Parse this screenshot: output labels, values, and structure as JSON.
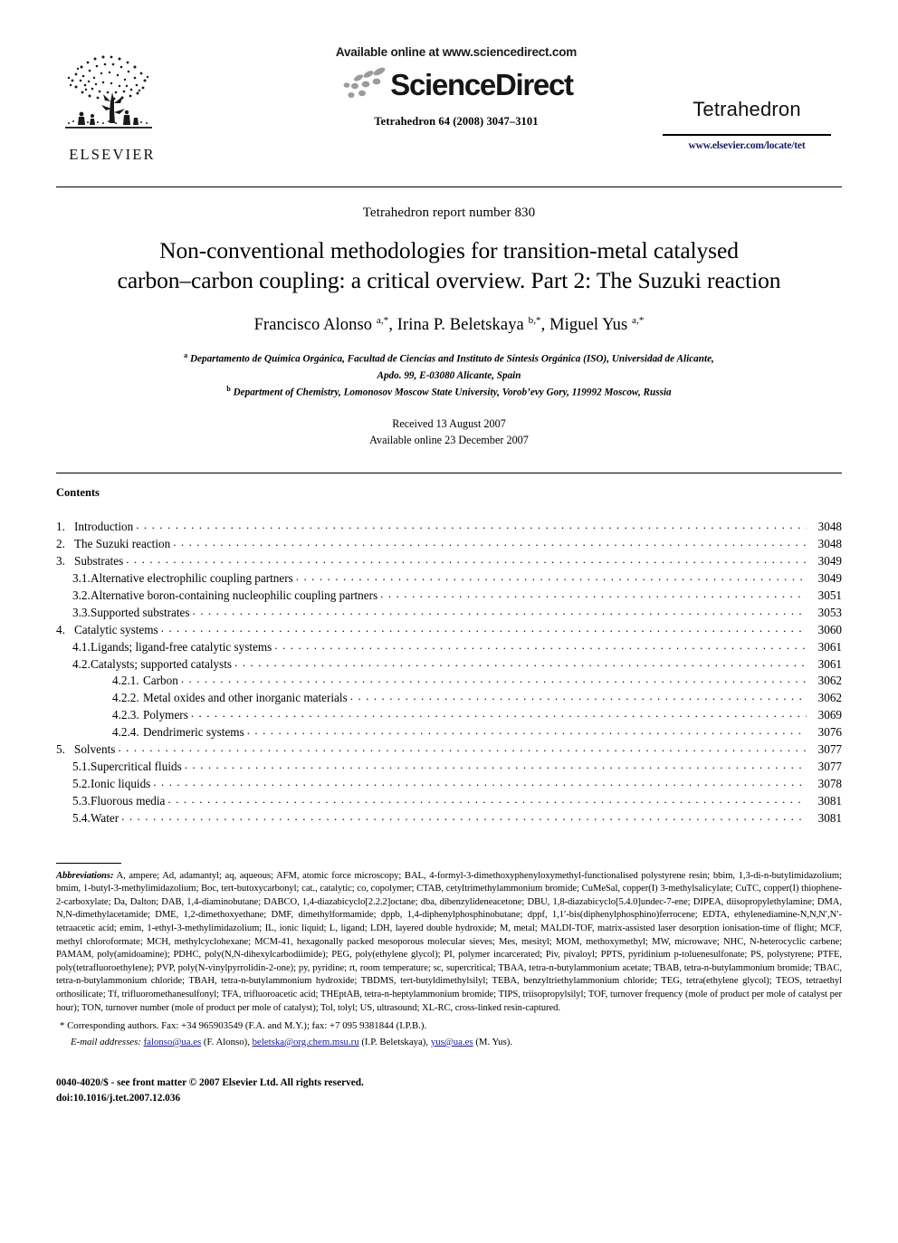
{
  "header": {
    "publisher_logo_text": "ELSEVIER",
    "available_online": "Available online at www.sciencedirect.com",
    "sciencedirect_wordmark": "ScienceDirect",
    "journal_reference": "Tetrahedron 64 (2008) 3047–3101",
    "journal_brand": "Tetrahedron",
    "journal_url": "www.elsevier.com/locate/tet"
  },
  "article": {
    "report_number": "Tetrahedron report number 830",
    "title_line1": "Non-conventional methodologies for transition-metal catalysed",
    "title_line2": "carbon–carbon coupling: a critical overview. Part 2: The Suzuki reaction",
    "authors": "Francisco Alonso a,*, Irina P. Beletskaya b,*, Miguel Yus a,*",
    "affiliation_a_line1": "Departamento de Química Orgánica, Facultad de Ciencias and Instituto de Síntesis Orgánica (ISO), Universidad de Alicante,",
    "affiliation_a_line2": "Apdo. 99, E-03080 Alicante, Spain",
    "affiliation_b": "Department of Chemistry, Lomonosov Moscow State University, Vorob’evy Gory, 119992 Moscow, Russia",
    "received": "Received 13 August 2007",
    "available_online": "Available online 23 December 2007"
  },
  "contents": {
    "heading": "Contents",
    "entries": [
      {
        "level": 0,
        "number": "1.",
        "label": "Introduction",
        "page": "3048"
      },
      {
        "level": 0,
        "number": "2.",
        "label": "The Suzuki reaction",
        "page": "3048"
      },
      {
        "level": 0,
        "number": "3.",
        "label": "Substrates",
        "page": "3049"
      },
      {
        "level": 1,
        "number": "3.1.",
        "label": "Alternative electrophilic coupling partners",
        "page": "3049"
      },
      {
        "level": 1,
        "number": "3.2.",
        "label": "Alternative boron-containing nucleophilic coupling partners",
        "page": "3051"
      },
      {
        "level": 1,
        "number": "3.3.",
        "label": "Supported substrates",
        "page": "3053"
      },
      {
        "level": 0,
        "number": "4.",
        "label": "Catalytic systems",
        "page": "3060"
      },
      {
        "level": 1,
        "number": "4.1.",
        "label": "Ligands; ligand-free catalytic systems",
        "page": "3061"
      },
      {
        "level": 1,
        "number": "4.2.",
        "label": "Catalysts; supported catalysts",
        "page": "3061"
      },
      {
        "level": 2,
        "number": "4.2.1.",
        "label": "Carbon",
        "page": "3062"
      },
      {
        "level": 2,
        "number": "4.2.2.",
        "label": "Metal oxides and other inorganic materials",
        "page": "3062"
      },
      {
        "level": 2,
        "number": "4.2.3.",
        "label": "Polymers",
        "page": "3069"
      },
      {
        "level": 2,
        "number": "4.2.4.",
        "label": "Dendrimeric systems",
        "page": "3076"
      },
      {
        "level": 0,
        "number": "5.",
        "label": "Solvents",
        "page": "3077"
      },
      {
        "level": 1,
        "number": "5.1.",
        "label": "Supercritical fluids",
        "page": "3077"
      },
      {
        "level": 1,
        "number": "5.2.",
        "label": "Ionic liquids",
        "page": "3078"
      },
      {
        "level": 1,
        "number": "5.3.",
        "label": "Fluorous media",
        "page": "3081"
      },
      {
        "level": 1,
        "number": "5.4.",
        "label": "Water",
        "page": "3081"
      }
    ]
  },
  "footnotes": {
    "abbrev_label": "Abbreviations:",
    "abbrev_text": " A, ampere; Ad, adamantyl; aq, aqueous; AFM, atomic force microscopy; BAL, 4-formyl-3-dimethoxyphenyloxymethyl-functionalised polystyrene resin; bbim, 1,3-di-n-butylimidazolium; bmim, 1-butyl-3-methylimidazolium; Boc, tert-butoxycarbonyl; cat., catalytic; co, copolymer; CTAB, cetyltrimethylammonium bromide; CuMeSal, copper(I) 3-methylsalicylate; CuTC, copper(I) thiophene-2-carboxylate; Da, Dalton; DAB, 1,4-diaminobutane; DABCO, 1,4-diazabicyclo[2.2.2]octane; dba, dibenzylideneacetone; DBU, 1,8-diazabicyclo[5.4.0]undec-7-ene; DIPEA, diisopropylethylamine; DMA, N,N-dimethylacetamide; DME, 1,2-dimethoxyethane; DMF, dimethylformamide; dppb, 1,4-diphenylphosphinobutane; dppf, 1,1′-bis(diphenylphosphino)ferrocene; EDTA, ethylenediamine-N,N,N′,N′-tetraacetic acid; emim, 1-ethyl-3-methylimidazolium; IL, ionic liquid; L, ligand; LDH, layered double hydroxide; M, metal; MALDI-TOF, matrix-assisted laser desorption ionisation-time of flight; MCF, methyl chloroformate; MCH, methylcyclohexane; MCM-41, hexagonally packed mesoporous molecular sieves; Mes, mesityl; MOM, methoxymethyl; MW, microwave; NHC, N-heterocyclic carbene; PAMAM, poly(amidoamine); PDHC, poly(N,N-dihexylcarbodiimide); PEG, poly(ethylene glycol); PI, polymer incarcerated; Piv, pivaloyl; PPTS, pyridinium p-toluenesulfonate; PS, polystyrene; PTFE, poly(tetrafluoroethylene); PVP, poly(N-vinylpyrrolidin-2-one); py, pyridine; rt, room temperature; sc, supercritical; TBAA, tetra-n-butylammonium acetate; TBAB, tetra-n-butylammonium bromide; TBAC, tetra-n-butylammonium chloride; TBAH, tetra-n-butylammonium hydroxide; TBDMS, tert-butyldimethylsilyl; TEBA, benzyltriethylammonium chloride; TEG, tetra(ethylene glycol); TEOS, tetraethyl orthosilicate; Tf, trifluoromethanesulfonyl; TFA, trifluoroacetic acid; THEptAB, tetra-n-heptylammonium bromide; TIPS, triisopropylsilyl; TOF, turnover frequency (mole of product per mole of catalyst per hour); TON, turnover number (mole of product per mole of catalyst); Tol, tolyl; US, ultrasound; XL-RC, cross-linked resin-captured.",
    "corresponding": "Corresponding authors. Fax: +34 965903549 (F.A. and M.Y.); fax: +7 095 9381844 (I.P.B.).",
    "email_label": "E-mail addresses:",
    "email_1": "falonso@ua.es",
    "email_1_owner": " (F. Alonso), ",
    "email_2": "beletska@org.chem.msu.ru",
    "email_2_owner": " (I.P. Beletskaya), ",
    "email_3": "yus@ua.es",
    "email_3_owner": " (M. Yus)."
  },
  "footer": {
    "copyright": "0040-4020/$ - see front matter © 2007 Elsevier Ltd. All rights reserved.",
    "doi": "doi:10.1016/j.tet.2007.12.036"
  },
  "colors": {
    "link": "#1a1a8c",
    "text": "#000000",
    "background": "#ffffff"
  }
}
